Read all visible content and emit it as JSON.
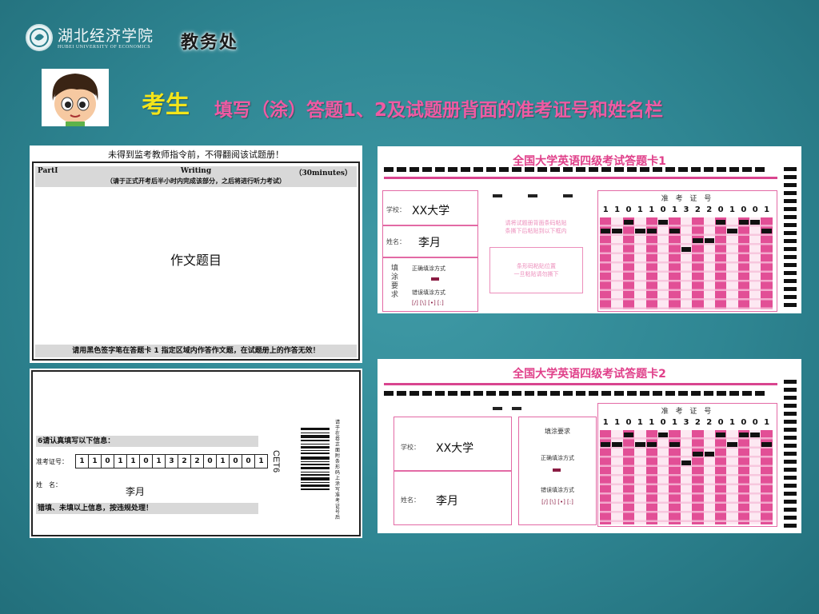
{
  "header": {
    "university_name": "湖北经济学院",
    "university_english": "HUBEI UNIVERSITY OF ECONOMICS",
    "office": "教务处"
  },
  "slide": {
    "title_main": "考生",
    "title_sub": "填写（涂）答题1、2及试题册背面的准考证号和姓名栏"
  },
  "exam_paper": {
    "warning": "未得到监考教师指令前，不得翻阅该试题册！",
    "part": "PartI",
    "section": "Writing",
    "minutes": "（30minutes）",
    "note": "（请于正式开考后半小时内完成该部分，之后将进行听力考试）",
    "essay_label": "作文题目",
    "footer": "请用黑色签字笔在答题卡 1 指定区域内作答作文题，在试题册上的作答无效！"
  },
  "back_cover": {
    "confirm_label": "6请认真填写以下信息：",
    "ticket_label": "准考证号：",
    "ticket_digits": [
      "1",
      "1",
      "0",
      "1",
      "1",
      "0",
      "1",
      "3",
      "2",
      "2",
      "0",
      "1",
      "0",
      "0",
      "1"
    ],
    "name_label": "姓　名：",
    "name_value": "李月",
    "penalty": "错填、未填以上信息，按违规处理！",
    "cet_label": "CET6",
    "vertical_note": "请于在卷正面附条形码上涂写准考证号后"
  },
  "card1": {
    "title": "全国大学英语四级考试答题卡1",
    "school_label": "学校：",
    "school_value": "XX大学",
    "name_label": "姓名：",
    "name_value": "李月",
    "fill_label": "填涂要求",
    "correct_label": "正确填涂方式",
    "wrong_label": "错误填涂方式",
    "barcode_note_1": "请将试题册背面条码粘贴",
    "barcode_note_2": "条撕下后粘贴到以下框内",
    "paste_note_1": "条形码粘贴位置",
    "paste_note_2": "一旦粘贴请勿撕下",
    "id_header": "准 考 证 号",
    "id_digits": [
      "1",
      "1",
      "0",
      "1",
      "1",
      "0",
      "1",
      "3",
      "2",
      "2",
      "0",
      "1",
      "0",
      "0",
      "1"
    ]
  },
  "card2": {
    "title": "全国大学英语四级考试答题卡2",
    "school_label": "学校：",
    "school_value": "XX大学",
    "name_label": "姓名：",
    "name_value": "李月",
    "fill_label": "填涂要求",
    "correct_label": "正确填涂方式",
    "wrong_label": "错误填涂方式",
    "id_header": "准 考 证 号",
    "id_digits": [
      "1",
      "1",
      "0",
      "1",
      "1",
      "0",
      "1",
      "3",
      "2",
      "2",
      "0",
      "1",
      "0",
      "0",
      "1"
    ]
  },
  "colors": {
    "background": "#2f8693",
    "title_yellow": "#f3e51a",
    "title_pink": "#ef5aa3",
    "card_pink": "#e24f96"
  }
}
